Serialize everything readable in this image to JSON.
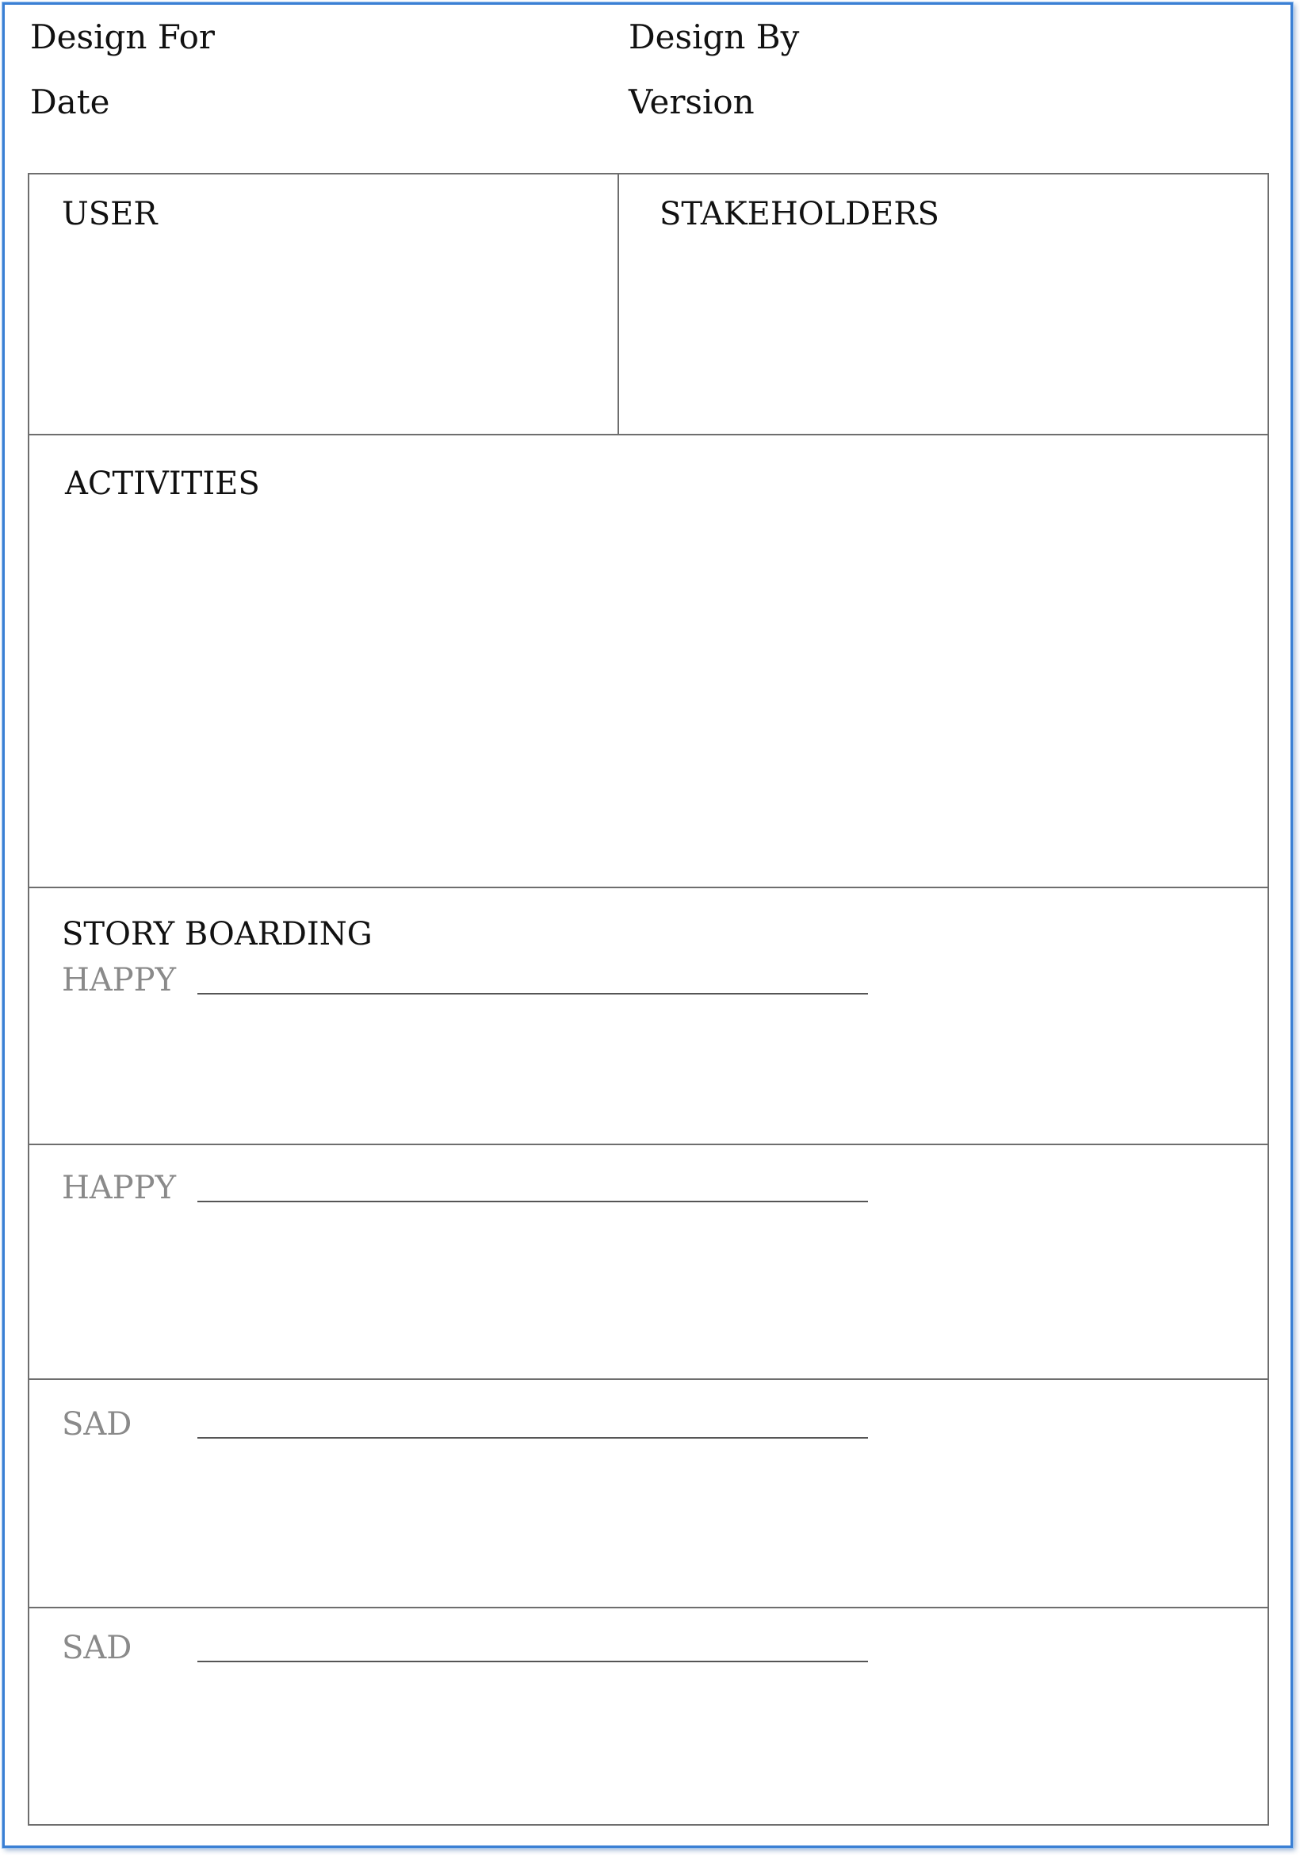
{
  "header": {
    "design_for_label": "Design For",
    "design_by_label": "Design By",
    "date_label": "Date",
    "version_label": "Version"
  },
  "sections": {
    "user": "USER",
    "stakeholders": "STAKEHOLDERS",
    "activities": "ACTIVITIES",
    "story_boarding": "STORY BOARDING"
  },
  "storyboard_rows": [
    {
      "label": "HAPPY"
    },
    {
      "label": "HAPPY"
    },
    {
      "label": "SAD"
    },
    {
      "label": "SAD"
    }
  ],
  "colors": {
    "frame_border": "#3a7fd4",
    "grid_line": "#6e6e6e",
    "mood_label": "#8a8a8a"
  }
}
